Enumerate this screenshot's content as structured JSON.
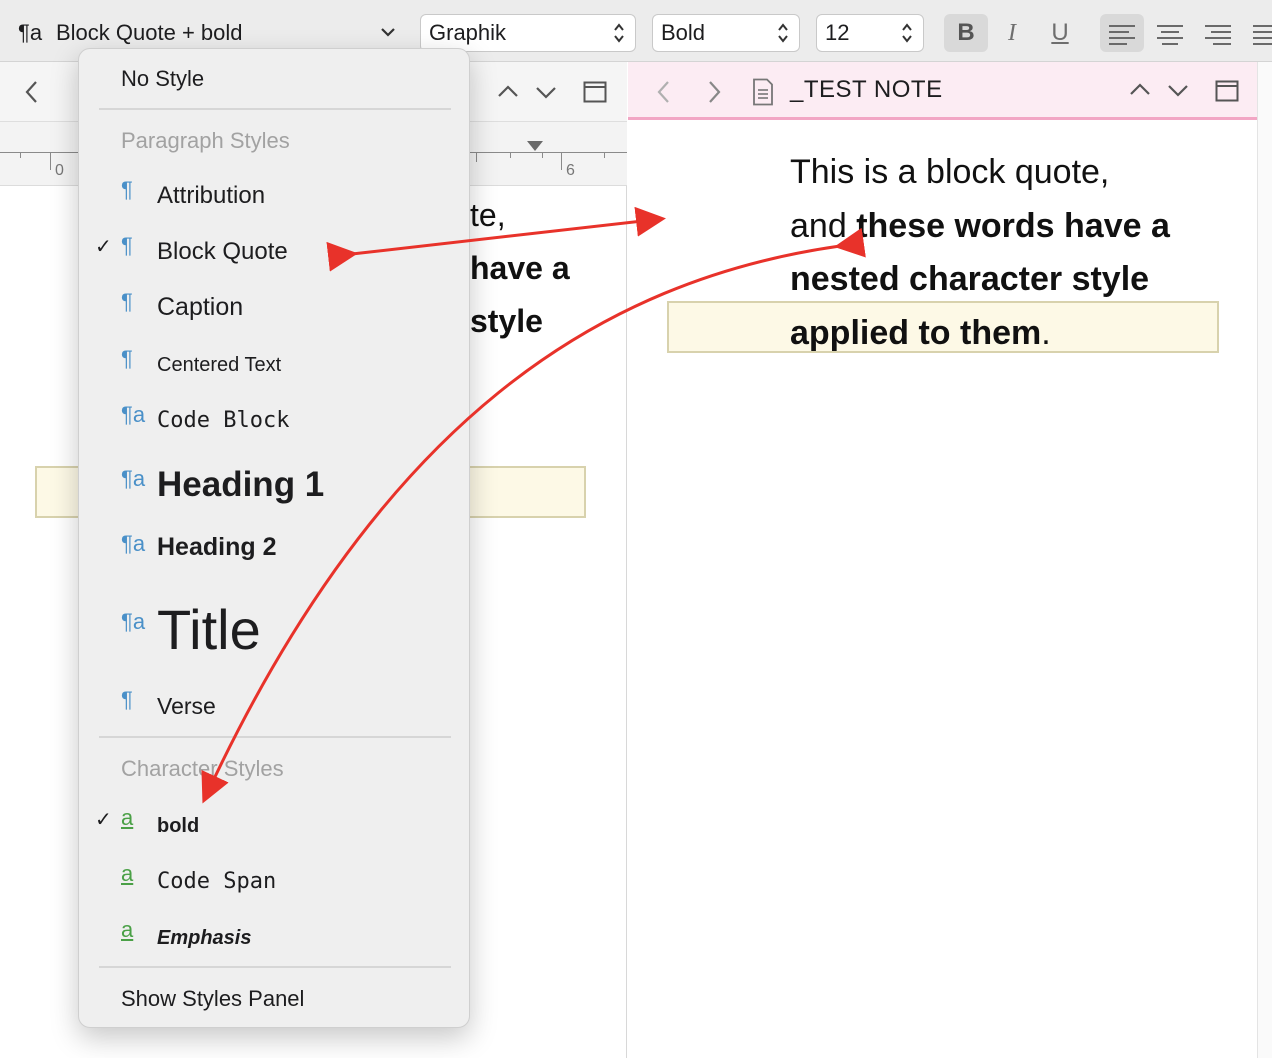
{
  "format_bar": {
    "paragraph_style_icon": "¶a",
    "paragraph_style": "Block Quote + bold",
    "font_family": "Graphik",
    "font_weight": "Bold",
    "font_size": "12",
    "bold_label": "B",
    "italic_label": "I",
    "underline_label": "U"
  },
  "left_editor": {
    "ruler": [
      "0",
      "6"
    ],
    "lines": [
      "te,",
      "have a",
      "style"
    ]
  },
  "right_editor": {
    "title": "_TEST NOTE",
    "quote_plain_1": "This is a block quote,",
    "quote_plain_2": "and ",
    "quote_bold_1": "these words have a",
    "quote_bold_2": "nested character style",
    "quote_bold_3": "applied to them",
    "quote_end": "."
  },
  "style_menu": {
    "no_style": "No Style",
    "paragraph_section": "Paragraph Styles",
    "paragraph_items": [
      {
        "label": "Attribution",
        "icon": "¶",
        "checked": false
      },
      {
        "label": "Block Quote",
        "icon": "¶",
        "checked": true
      },
      {
        "label": "Caption",
        "icon": "¶",
        "checked": false
      },
      {
        "label": "Centered Text",
        "icon": "¶",
        "checked": false
      },
      {
        "label": "Code Block",
        "icon": "¶a",
        "checked": false
      },
      {
        "label": "Heading 1",
        "icon": "¶a",
        "checked": false
      },
      {
        "label": "Heading 2",
        "icon": "¶a",
        "checked": false
      },
      {
        "label": "Title",
        "icon": "¶a",
        "checked": false
      },
      {
        "label": "Verse",
        "icon": "¶",
        "checked": false
      }
    ],
    "character_section": "Character Styles",
    "character_items": [
      {
        "label": "bold",
        "icon": "a",
        "checked": true
      },
      {
        "label": "Code Span",
        "icon": "a",
        "checked": false
      },
      {
        "label": "Emphasis",
        "icon": "a",
        "checked": false
      }
    ],
    "show_panel": "Show Styles Panel",
    "check_mark": "✓"
  },
  "colors": {
    "annotation_arrow": "#e8322a",
    "paragraph_icon": "#4a90c8",
    "character_icon": "#4aa046",
    "header_accent": "#f2a6c4",
    "highlight": "#fdf9e6"
  }
}
